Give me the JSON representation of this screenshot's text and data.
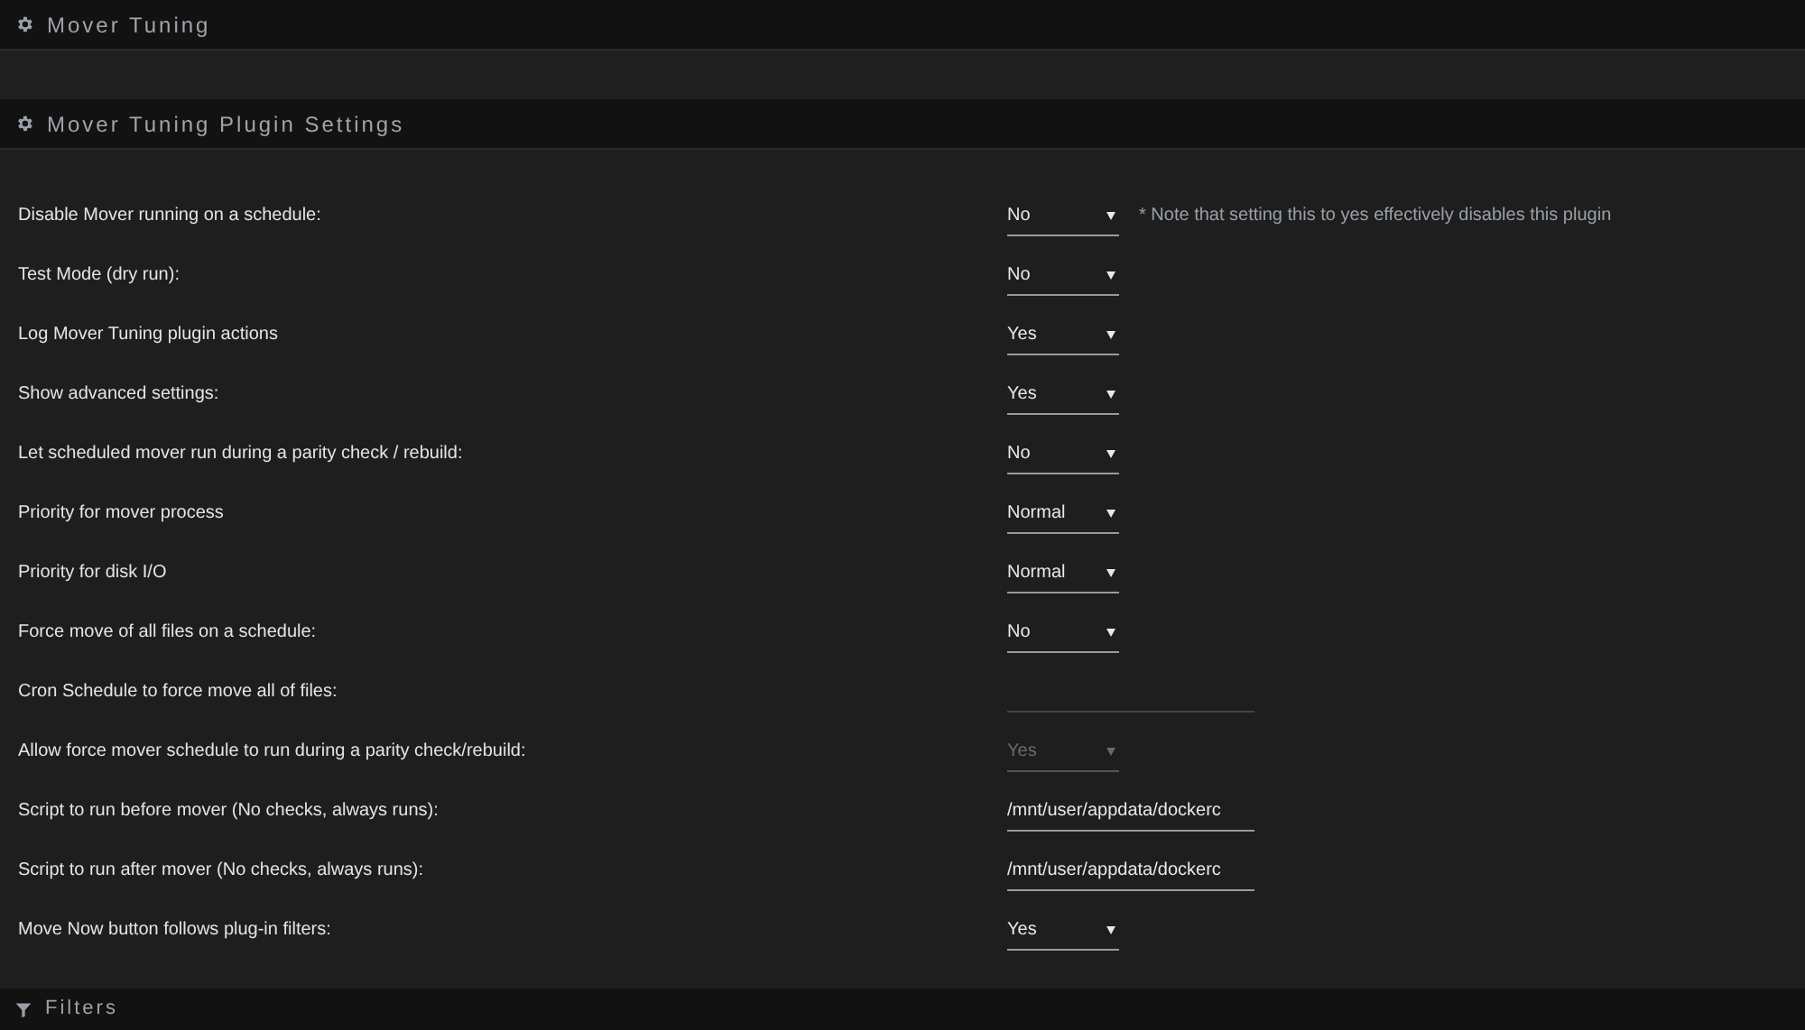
{
  "sections": [
    {
      "title": "Mover Tuning"
    },
    {
      "title": "Mover Tuning Plugin Settings"
    }
  ],
  "settings": [
    {
      "label": "Disable Mover running on a schedule:",
      "kind": "select",
      "value": "No",
      "disabled": false,
      "note": "* Note that setting this to yes effectively disables this plugin"
    },
    {
      "label": "Test Mode (dry run):",
      "kind": "select",
      "value": "No",
      "disabled": false
    },
    {
      "label": "Log Mover Tuning plugin actions",
      "kind": "select",
      "value": "Yes",
      "disabled": false
    },
    {
      "label": "Show advanced settings:",
      "kind": "select",
      "value": "Yes",
      "disabled": false
    },
    {
      "label": "Let scheduled mover run during a parity check / rebuild:",
      "kind": "select",
      "value": "No",
      "disabled": false
    },
    {
      "label": "Priority for mover process",
      "kind": "select",
      "value": "Normal",
      "disabled": false
    },
    {
      "label": "Priority for disk I/O",
      "kind": "select",
      "value": "Normal",
      "disabled": false
    },
    {
      "label": "Force move of all files on a schedule:",
      "kind": "select",
      "value": "No",
      "disabled": false
    },
    {
      "label": "Cron Schedule to force move all of files:",
      "kind": "text"
    },
    {
      "label": "Allow force mover schedule to run during a parity check/rebuild:",
      "kind": "select",
      "value": "Yes",
      "disabled": true
    },
    {
      "label": "Script to run before mover (No checks, always runs):",
      "kind": "text",
      "value": "/mnt/user/appdata/dockerc"
    },
    {
      "label": "Script to run after mover (No checks, always runs):",
      "kind": "text",
      "value": "/mnt/user/appdata/dockerc"
    },
    {
      "label": "Move Now button follows plug-in filters:",
      "kind": "select",
      "value": "Yes",
      "disabled": false
    }
  ],
  "footer_section": {
    "title": "Filters"
  }
}
